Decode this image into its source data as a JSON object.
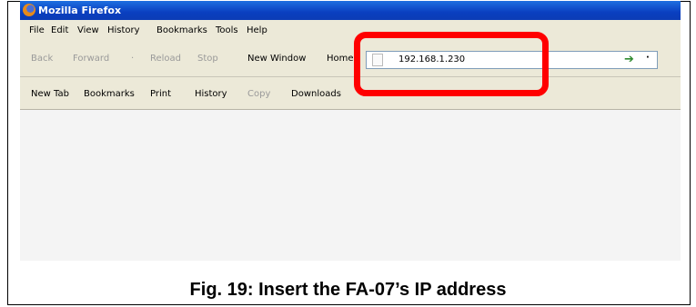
{
  "window": {
    "title": "Mozilla Firefox"
  },
  "menu": [
    "File",
    "Edit",
    "View",
    "History",
    "Bookmarks",
    "Tools",
    "Help"
  ],
  "navigation": {
    "back": "Back",
    "forward": "Forward",
    "reload": "Reload",
    "stop": "Stop",
    "new_window": "New Window",
    "home": "Home",
    "url": "192.168.1.230"
  },
  "bookmarks_bar": [
    "New Tab",
    "Bookmarks",
    "Print",
    "History",
    "Copy",
    "Downloads"
  ],
  "caption": "Fig. 19: Insert the FA-07’s IP address",
  "colors": {
    "highlight": "#ff0000",
    "titlebar": "#0a3fc0"
  }
}
